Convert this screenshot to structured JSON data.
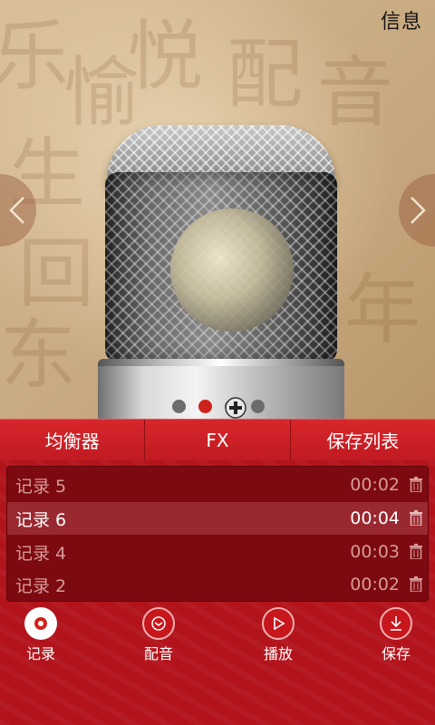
{
  "header": {
    "info_label": "信息"
  },
  "tabs": [
    {
      "label": "均衡器"
    },
    {
      "label": "FX"
    },
    {
      "label": "保存列表"
    }
  ],
  "recordings": [
    {
      "name": "记录 5",
      "duration": "00:02",
      "selected": false
    },
    {
      "name": "记录 6",
      "duration": "00:04",
      "selected": true
    },
    {
      "name": "记录 4",
      "duration": "00:03",
      "selected": false
    },
    {
      "name": "记录 2",
      "duration": "00:02",
      "selected": false
    }
  ],
  "toolbar": {
    "record_label": "记录",
    "dub_label": "配音",
    "play_label": "播放",
    "save_label": "保存"
  },
  "pager": {
    "total": 4,
    "active_index": 1
  },
  "colors": {
    "accent": "#d0221c",
    "panel": "#7d0a10",
    "selected_row": "#9a2830"
  },
  "icons": [
    "chevron-left-icon",
    "chevron-right-icon",
    "add-icon",
    "trash-icon",
    "record-icon",
    "dub-icon",
    "play-icon",
    "download-icon"
  ]
}
